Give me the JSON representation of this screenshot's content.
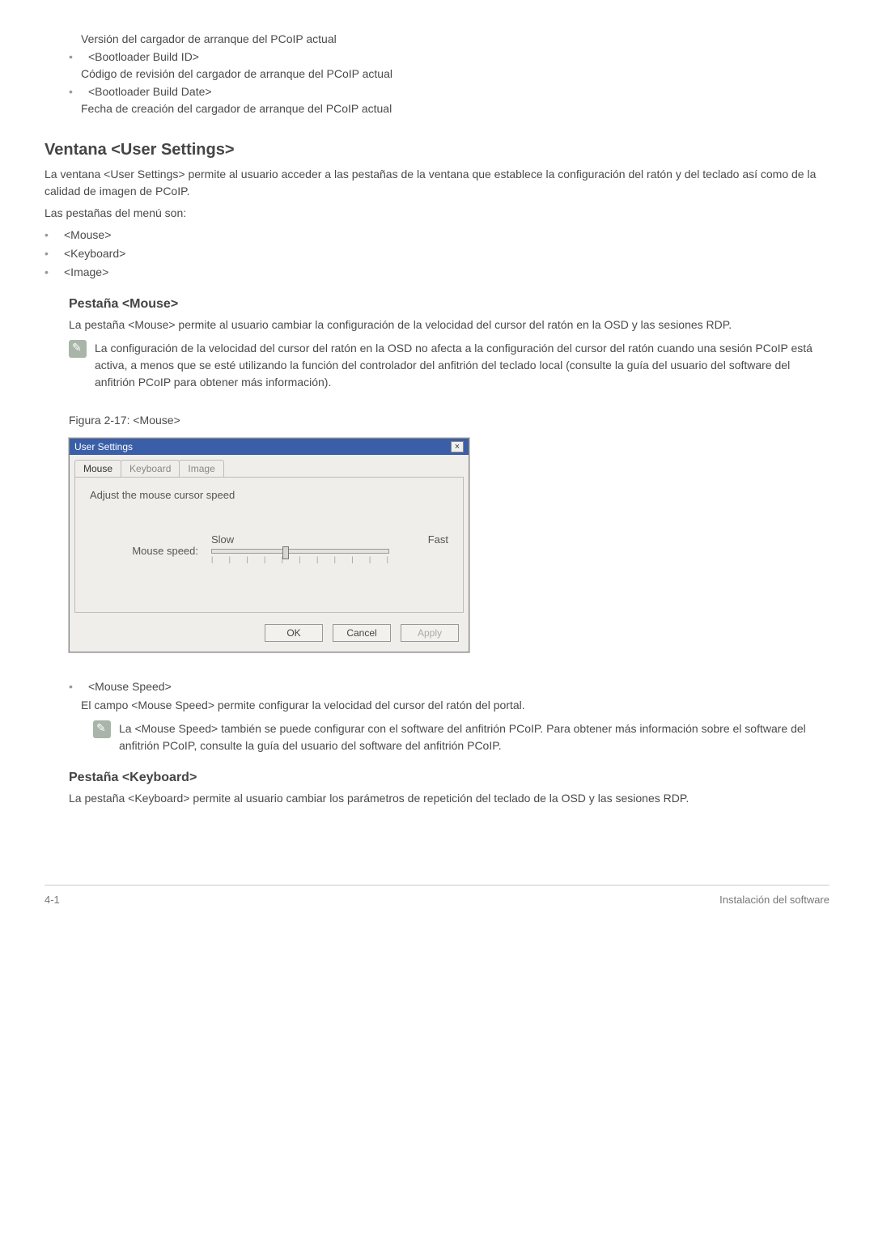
{
  "topList": {
    "line0": "Versión del cargador de arranque del PCoIP actual",
    "item1": {
      "title": "<Bootloader Build ID>",
      "desc": "Código de revisión del cargador de arranque del PCoIP actual"
    },
    "item2": {
      "title": "<Bootloader Build Date>",
      "desc": "Fecha de creación del cargador de arranque del PCoIP actual"
    }
  },
  "section1": {
    "heading": "Ventana <User Settings>",
    "p1": "La ventana <User Settings> permite al usuario acceder a las pestañas de la ventana que establece la configuración del ratón y del teclado así como de la calidad de imagen de PCoIP.",
    "p2": "Las pestañas del menú son:",
    "bullets": [
      "<Mouse>",
      "<Keyboard>",
      "<Image>"
    ]
  },
  "mouse": {
    "heading": "Pestaña <Mouse>",
    "p1": "La pestaña <Mouse> permite al usuario cambiar la configuración de la velocidad del cursor del ratón en la OSD y las sesiones RDP.",
    "note": "La configuración de la velocidad del cursor del ratón en la OSD no afecta a la configuración del cursor del ratón cuando una sesión PCoIP está activa, a menos que se esté utilizando la función del controlador del anfitrión del teclado local (consulte la guía del usuario del software del anfitrión PCoIP para obtener más información).",
    "figCaption": "Figura 2-17: <Mouse>"
  },
  "dialog": {
    "title": "User Settings",
    "tabs": {
      "mouse": "Mouse",
      "keyboard": "Keyboard",
      "image": "Image"
    },
    "adjust": "Adjust the mouse cursor speed",
    "speedLabel": "Mouse speed:",
    "slow": "Slow",
    "fast": "Fast",
    "ok": "OK",
    "cancel": "Cancel",
    "apply": "Apply"
  },
  "mouseSpeed": {
    "title": "<Mouse Speed>",
    "desc": "El campo <Mouse Speed> permite configurar la velocidad del cursor del ratón del portal.",
    "note": "La <Mouse Speed> también se puede configurar con el software del anfitrión PCoIP. Para obtener más información sobre el software del anfitrión PCoIP, consulte la guía del usuario del software del anfitrión PCoIP."
  },
  "keyboard": {
    "heading": "Pestaña <Keyboard>",
    "p1": "La pestaña <Keyboard> permite al usuario cambiar los parámetros de repetición del teclado de la OSD y las sesiones RDP."
  },
  "footer": {
    "left": "4-1",
    "right": "Instalación del software"
  }
}
